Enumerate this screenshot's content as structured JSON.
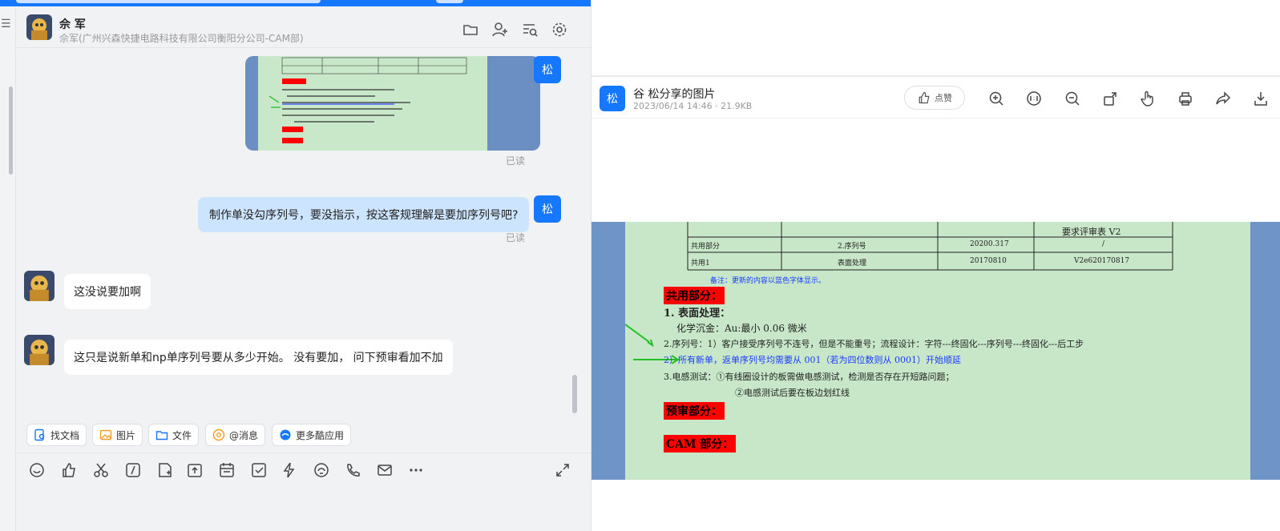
{
  "chat": {
    "contact_name": "佘 军",
    "contact_org": "佘军(广州兴森快捷电路科技有限公司衡阳分公司-CAM部)",
    "my_avatar_label": "松",
    "messages": [
      {
        "from": "me",
        "type": "image",
        "status": "已读"
      },
      {
        "from": "me",
        "type": "text",
        "text": "制作单没勾序列号，要没指示，按这客规理解是要加序列号吧?",
        "status": "已读"
      },
      {
        "from": "other",
        "type": "text",
        "text": "这没说要加啊"
      },
      {
        "from": "other",
        "type": "text",
        "text": "这只是说新单和np单序列号要从多少开始。 没有要加， 问下预审看加不加"
      }
    ],
    "quick_actions": [
      "找文档",
      "图片",
      "文件",
      "@消息",
      "更多酷应用"
    ]
  },
  "viewer": {
    "avatar_label": "松",
    "title": "谷  松分享的图片",
    "meta": "2023/06/14 14:46 · 21.9KB",
    "like_label": "点赞"
  },
  "document": {
    "table_header": "要求评审表 V2",
    "table_rows": [
      [
        "共用部分",
        "2.序列号",
        "20200.317",
        "/"
      ],
      [
        "共用1",
        "表面处理",
        "20170810",
        "V2e620170817"
      ]
    ],
    "note": "备注：更新的内容以蓝色字体显示。",
    "sec_common": "共用部分：",
    "item1": "1. 表面处理：",
    "item1_sub": "化学沉金：Au:最小 0.06 微米",
    "item2": "2.序列号：1）客户接受序列号不连号，但是不能重号；流程设计：字符---终固化---序列号---终固化---后工步",
    "item2_sub": "2）所有新单，返单序列号均需要从 001（若为四位数则从 0001）开始顺延",
    "item3": "3.电感测试：①有线圈设计的板需做电感测试，检测是否存在开短路问题；",
    "item3_sub": "②电感测试后要在板边划红线",
    "sec_pre": "预审部分：",
    "sec_cam": "CAM 部分："
  },
  "colors": {
    "accent": "#1677ff",
    "bubble_me": "#cde4ff",
    "doc_bg": "#c8e7c8",
    "highlight_red": "#ff0000",
    "arrow_green": "#22c022",
    "text_blue": "#1a3cff"
  }
}
